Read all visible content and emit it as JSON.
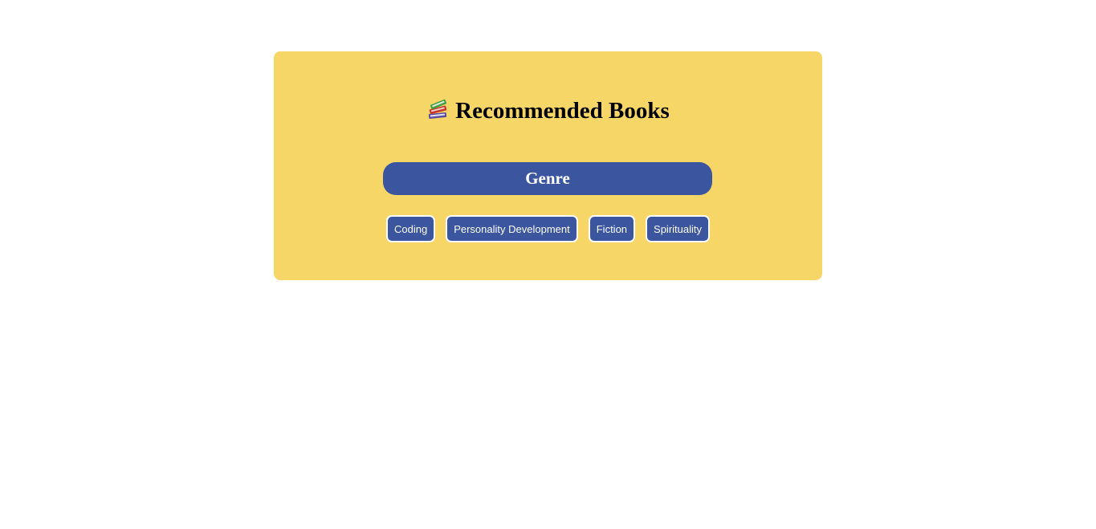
{
  "header": {
    "icon": "books-icon",
    "title": "Recommended Books"
  },
  "genre": {
    "heading": "Genre",
    "options": [
      "Coding",
      "Personality Development",
      "Fiction",
      "Spirituality"
    ]
  },
  "colors": {
    "card_background": "#f6d667",
    "accent": "#3b569f",
    "text_on_accent": "#ffffff",
    "page_background": "#ffffff"
  }
}
